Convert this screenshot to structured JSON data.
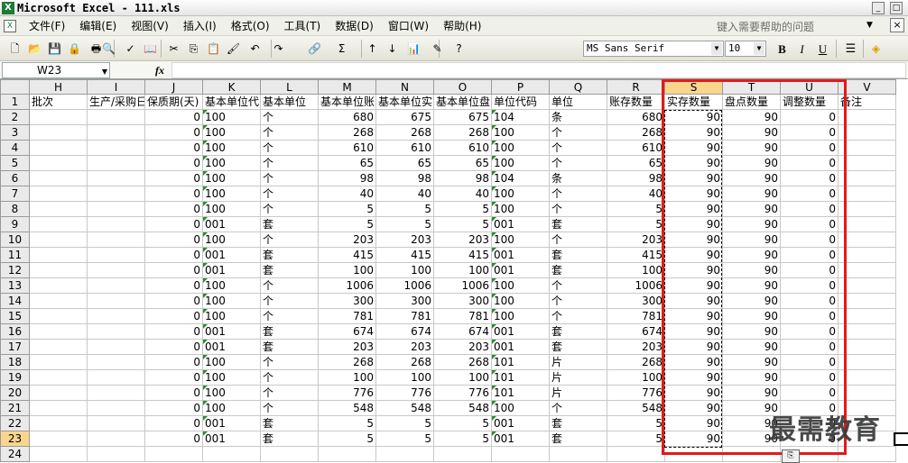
{
  "window": {
    "title": "Microsoft Excel - 111.xls",
    "app_icon": "X",
    "buttons": [
      "_",
      "□"
    ]
  },
  "menu": {
    "items": [
      "文件(F)",
      "编辑(E)",
      "视图(V)",
      "插入(I)",
      "格式(O)",
      "工具(T)",
      "数据(D)",
      "窗口(W)",
      "帮助(H)"
    ],
    "help_placeholder": "键入需要帮助的问题",
    "close": "×"
  },
  "toolbar": {
    "icons": [
      "new-icon",
      "open-icon",
      "save-icon",
      "permission-icon",
      "print-icon",
      "print-preview-icon",
      "spelling-icon",
      "research-icon",
      "cut-icon",
      "copy-icon",
      "paste-icon",
      "format-painter-icon",
      "undo-icon",
      "redo-icon",
      "hyperlink-icon",
      "autosum-icon",
      "sort-ascending-icon",
      "sort-descending-icon",
      "chart-wizard-icon",
      "drawing-icon",
      "help-icon"
    ],
    "glyphs": [
      "🗋",
      "📂",
      "💾",
      "🔒",
      "🖶",
      "🔍",
      "✓",
      "📖",
      "✂",
      "⎘",
      "📋",
      "🖌",
      "↶",
      "↷",
      "🔗",
      "Σ",
      "↑",
      "↓",
      "📊",
      "✎",
      "?"
    ],
    "font_name": "MS Sans Serif",
    "font_size": "10",
    "bold": "B",
    "italic": "I",
    "underline": "U",
    "fill_icon": "◈"
  },
  "formula_bar": {
    "name_box": "W23",
    "fx": "fx",
    "content": ""
  },
  "sheet": {
    "columns": [
      "H",
      "I",
      "J",
      "K",
      "L",
      "M",
      "N",
      "O",
      "P",
      "Q",
      "R",
      "S",
      "T",
      "U",
      "V"
    ],
    "selected_columns": [
      "S"
    ],
    "rows": [
      {
        "n": "1",
        "cells": [
          "批次",
          "生产/采购日",
          "保质期(天)",
          "基本单位代",
          "基本单位",
          "基本单位账",
          "基本单位实",
          "基本单位盘",
          "单位代码",
          "单位",
          "账存数量",
          "实存数量",
          "盘点数量",
          "调整数量",
          "备注"
        ]
      },
      {
        "n": "2",
        "cells": [
          "",
          "",
          "0",
          "100",
          "个",
          "680",
          "675",
          "675",
          "104",
          "条",
          "680",
          "90",
          "90",
          "0",
          ""
        ]
      },
      {
        "n": "3",
        "cells": [
          "",
          "",
          "0",
          "100",
          "个",
          "268",
          "268",
          "268",
          "100",
          "个",
          "268",
          "90",
          "90",
          "0",
          ""
        ]
      },
      {
        "n": "4",
        "cells": [
          "",
          "",
          "0",
          "100",
          "个",
          "610",
          "610",
          "610",
          "100",
          "个",
          "610",
          "90",
          "90",
          "0",
          ""
        ]
      },
      {
        "n": "5",
        "cells": [
          "",
          "",
          "0",
          "100",
          "个",
          "65",
          "65",
          "65",
          "100",
          "个",
          "65",
          "90",
          "90",
          "0",
          ""
        ]
      },
      {
        "n": "6",
        "cells": [
          "",
          "",
          "0",
          "100",
          "个",
          "98",
          "98",
          "98",
          "104",
          "条",
          "98",
          "90",
          "90",
          "0",
          ""
        ]
      },
      {
        "n": "7",
        "cells": [
          "",
          "",
          "0",
          "100",
          "个",
          "40",
          "40",
          "40",
          "100",
          "个",
          "40",
          "90",
          "90",
          "0",
          ""
        ]
      },
      {
        "n": "8",
        "cells": [
          "",
          "",
          "0",
          "100",
          "个",
          "5",
          "5",
          "5",
          "100",
          "个",
          "5",
          "90",
          "90",
          "0",
          ""
        ]
      },
      {
        "n": "9",
        "cells": [
          "",
          "",
          "0",
          "001",
          "套",
          "5",
          "5",
          "5",
          "001",
          "套",
          "5",
          "90",
          "90",
          "0",
          ""
        ]
      },
      {
        "n": "10",
        "cells": [
          "",
          "",
          "0",
          "100",
          "个",
          "203",
          "203",
          "203",
          "100",
          "个",
          "203",
          "90",
          "90",
          "0",
          ""
        ]
      },
      {
        "n": "11",
        "cells": [
          "",
          "",
          "0",
          "001",
          "套",
          "415",
          "415",
          "415",
          "001",
          "套",
          "415",
          "90",
          "90",
          "0",
          ""
        ]
      },
      {
        "n": "12",
        "cells": [
          "",
          "",
          "0",
          "001",
          "套",
          "100",
          "100",
          "100",
          "001",
          "套",
          "100",
          "90",
          "90",
          "0",
          ""
        ]
      },
      {
        "n": "13",
        "cells": [
          "",
          "",
          "0",
          "100",
          "个",
          "1006",
          "1006",
          "1006",
          "100",
          "个",
          "1006",
          "90",
          "90",
          "0",
          ""
        ]
      },
      {
        "n": "14",
        "cells": [
          "",
          "",
          "0",
          "100",
          "个",
          "300",
          "300",
          "300",
          "100",
          "个",
          "300",
          "90",
          "90",
          "0",
          ""
        ]
      },
      {
        "n": "15",
        "cells": [
          "",
          "",
          "0",
          "100",
          "个",
          "781",
          "781",
          "781",
          "100",
          "个",
          "781",
          "90",
          "90",
          "0",
          ""
        ]
      },
      {
        "n": "16",
        "cells": [
          "",
          "",
          "0",
          "001",
          "套",
          "674",
          "674",
          "674",
          "001",
          "套",
          "674",
          "90",
          "90",
          "0",
          ""
        ]
      },
      {
        "n": "17",
        "cells": [
          "",
          "",
          "0",
          "001",
          "套",
          "203",
          "203",
          "203",
          "001",
          "套",
          "203",
          "90",
          "90",
          "0",
          ""
        ]
      },
      {
        "n": "18",
        "cells": [
          "",
          "",
          "0",
          "100",
          "个",
          "268",
          "268",
          "268",
          "101",
          "片",
          "268",
          "90",
          "90",
          "0",
          ""
        ]
      },
      {
        "n": "19",
        "cells": [
          "",
          "",
          "0",
          "100",
          "个",
          "100",
          "100",
          "100",
          "101",
          "片",
          "100",
          "90",
          "90",
          "0",
          ""
        ]
      },
      {
        "n": "20",
        "cells": [
          "",
          "",
          "0",
          "100",
          "个",
          "776",
          "776",
          "776",
          "101",
          "片",
          "776",
          "90",
          "90",
          "0",
          ""
        ]
      },
      {
        "n": "21",
        "cells": [
          "",
          "",
          "0",
          "100",
          "个",
          "548",
          "548",
          "548",
          "100",
          "个",
          "548",
          "90",
          "90",
          "0",
          ""
        ]
      },
      {
        "n": "22",
        "cells": [
          "",
          "",
          "0",
          "001",
          "套",
          "5",
          "5",
          "5",
          "001",
          "套",
          "5",
          "90",
          "90",
          "0",
          ""
        ]
      },
      {
        "n": "23",
        "cells": [
          "",
          "",
          "0",
          "001",
          "套",
          "5",
          "5",
          "5",
          "001",
          "套",
          "5",
          "90",
          "90",
          "0",
          ""
        ]
      },
      {
        "n": "24",
        "cells": [
          "",
          "",
          "",
          "",
          "",
          "",
          "",
          "",
          "",
          "",
          "",
          "",
          "",
          "",
          ""
        ]
      }
    ],
    "selected_row": "23"
  },
  "watermark": "最需教育",
  "paste_options_icon": "⎘"
}
